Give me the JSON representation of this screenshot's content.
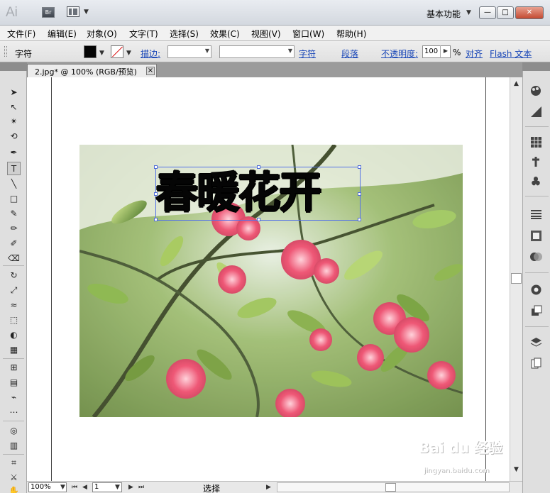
{
  "app": {
    "logo": "Ai",
    "bridge": "Br",
    "workspace": "基本功能"
  },
  "menu": [
    "文件(F)",
    "编辑(E)",
    "对象(O)",
    "文字(T)",
    "选择(S)",
    "效果(C)",
    "视图(V)",
    "窗口(W)",
    "帮助(H)"
  ],
  "control": {
    "mode": "字符",
    "stroke_label": "描边:",
    "character_link": "字符",
    "paragraph_link": "段落",
    "opacity_label": "不透明度:",
    "opacity_value": "100",
    "opacity_unit": "%",
    "align_link": "对齐",
    "flash_link": "Flash 文本"
  },
  "document": {
    "tab": "2.jpg* @ 100% (RGB/预览)",
    "headline": "春暖花开"
  },
  "status": {
    "zoom": "100%",
    "page": "1",
    "selection": "选择"
  },
  "watermark": {
    "brand": "Bai du 经验",
    "url": "jingyan.baidu.com"
  },
  "colors": {
    "accent": "#1745b7",
    "selection": "#5371e7",
    "flower": "#ee4f6f",
    "leaf": "#8ab64a"
  }
}
